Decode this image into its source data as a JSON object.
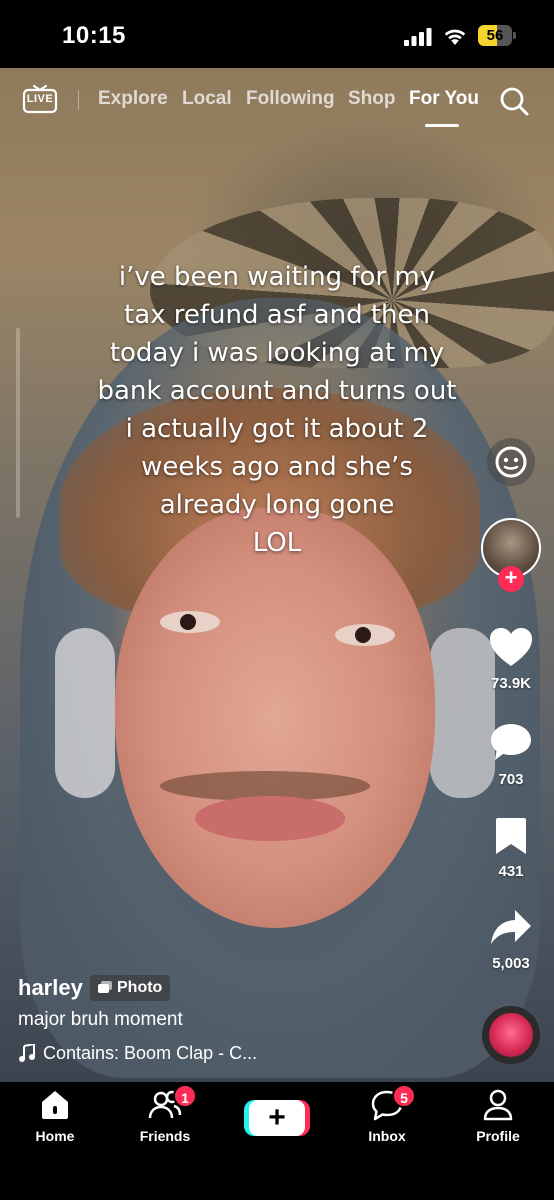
{
  "status_bar": {
    "time": "10:15",
    "battery_percent": "56",
    "battery_level": 0.56,
    "battery_color": "#f5d42c"
  },
  "top_nav": {
    "live_label": "LIVE",
    "tabs": [
      {
        "label": "Explore",
        "active": false
      },
      {
        "label": "Local",
        "active": false
      },
      {
        "label": "Following",
        "active": false
      },
      {
        "label": "Shop",
        "active": false
      },
      {
        "label": "For You",
        "active": true
      }
    ],
    "search_icon": "search-icon"
  },
  "post": {
    "overlay_text": "i’ve been waiting for my\ntax refund asf and then\ntoday i was looking at my\nbank account and turns out\ni actually got it about 2\nweeks ago and she’s\nalready long gone\nLOL",
    "username": "harley",
    "type_badge": "Photo",
    "description": "major bruh moment",
    "sound": "Contains: Boom Clap - C..."
  },
  "rail": {
    "likes": "73.9K",
    "comments": "703",
    "saves": "431",
    "shares": "5,003",
    "follow_symbol": "+",
    "accent_color": "#fe2c55"
  },
  "tab_bar": {
    "home": "Home",
    "friends": "Friends",
    "friends_badge": "1",
    "create_symbol": "+",
    "inbox": "Inbox",
    "inbox_badge": "5",
    "profile": "Profile"
  }
}
